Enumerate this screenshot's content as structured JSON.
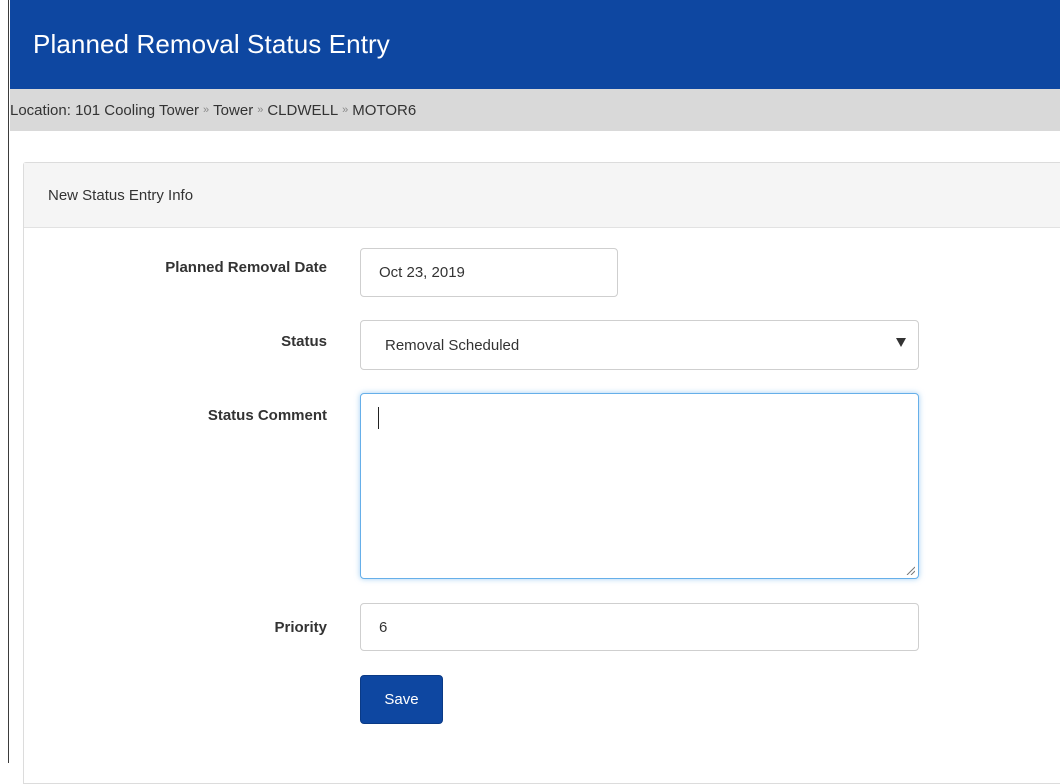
{
  "header": {
    "title": "Planned Removal Status Entry"
  },
  "breadcrumb": {
    "prefix": "Location:",
    "items": [
      "101 Cooling Tower",
      "Tower",
      "CLDWELL",
      "MOTOR6"
    ],
    "separator": "»"
  },
  "panel": {
    "title": "New Status Entry Info"
  },
  "form": {
    "planned_removal_date": {
      "label": "Planned Removal Date",
      "value": "Oct 23, 2019"
    },
    "status": {
      "label": "Status",
      "value": "Removal Scheduled"
    },
    "status_comment": {
      "label": "Status Comment",
      "value": ""
    },
    "priority": {
      "label": "Priority",
      "value": "6"
    },
    "save_label": "Save"
  },
  "colors": {
    "brand": "#0e47a1",
    "breadcrumb_bg": "#d9d9d9",
    "focus": "#66afe9"
  }
}
